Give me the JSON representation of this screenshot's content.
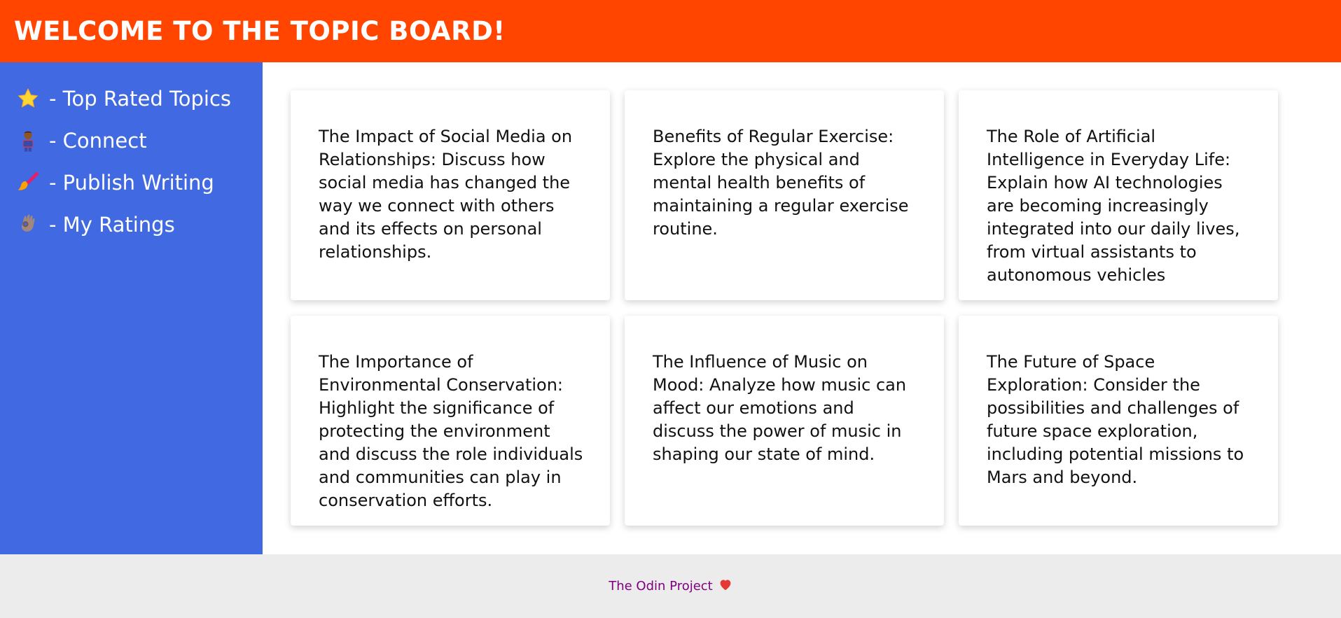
{
  "header": {
    "title": "WELCOME TO THE TOPIC BOARD!",
    "background": "#ff4500"
  },
  "sidebar": {
    "background": "#4169e1",
    "items": [
      {
        "icon": "star-icon",
        "label": "- Top Rated Topics"
      },
      {
        "icon": "person-icon",
        "label": "- Connect"
      },
      {
        "icon": "paintbrush-icon",
        "label": "- Publish Writing"
      },
      {
        "icon": "ok-hand-icon",
        "label": "- My Ratings"
      }
    ]
  },
  "cards": [
    {
      "text": "The Impact of Social Media on Relationships: Discuss how social media has changed the way we connect with others and its effects on personal relationships."
    },
    {
      "text": "Benefits of Regular Exercise: Explore the physical and mental health benefits of maintaining a regular exercise routine."
    },
    {
      "text": "The Role of Artificial Intelligence in Everyday Life: Explain how AI technologies are becoming increasingly integrated into our daily lives, from virtual assistants to autonomous vehicles"
    },
    {
      "text": "The Importance of Environmental Conservation: Highlight the significance of protecting the environment and discuss the role individuals and communities can play in conservation efforts."
    },
    {
      "text": "The Influence of Music on Mood: Analyze how music can affect our emotions and discuss the power of music in shaping our state of mind."
    },
    {
      "text": "The Future of Space Exploration: Consider the possibilities and challenges of future space exploration, including potential missions to Mars and beyond."
    }
  ],
  "footer": {
    "link_text": "The Odin Project",
    "icon": "heart-icon",
    "link_color": "#800080",
    "background": "#ececec"
  }
}
